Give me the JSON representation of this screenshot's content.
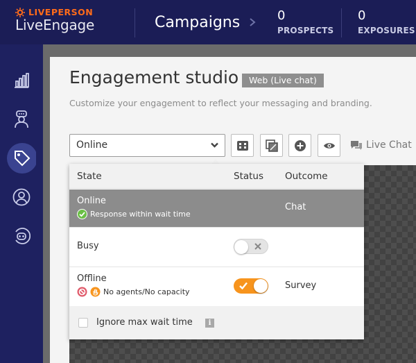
{
  "header": {
    "brand_top": "LIVEPERSON",
    "brand_bottom": "LiveEngage",
    "section_title": "Campaigns",
    "stats": [
      {
        "value": "0",
        "label": "PROSPECTS"
      },
      {
        "value": "0",
        "label": "EXPOSURES"
      }
    ]
  },
  "leftnav": {
    "items": [
      {
        "icon": "bar-chart-icon",
        "active": false
      },
      {
        "icon": "agent-icon",
        "active": false
      },
      {
        "icon": "tag-icon",
        "active": true
      },
      {
        "icon": "user-circle-icon",
        "active": false
      },
      {
        "icon": "bot-icon",
        "active": false
      }
    ]
  },
  "studio": {
    "title": "Engagement studio",
    "badge": "Web (Live chat)",
    "subtitle": "Customize your engagement to reflect your messaging and branding.",
    "state_select_value": "Online",
    "live_chat_label": "Live Chat"
  },
  "states_table": {
    "headers": {
      "state": "State",
      "status": "Status",
      "outcome": "Outcome"
    },
    "rows": [
      {
        "state": "Online",
        "sub": "Response within wait time",
        "outcome": "Chat",
        "selected": true
      },
      {
        "state": "Busy",
        "toggle": "off",
        "outcome": ""
      },
      {
        "state": "Offline",
        "sub": "No agents/No capacity",
        "toggle": "on",
        "outcome": "Survey"
      }
    ],
    "footer_label": "Ignore max wait time",
    "footer_checked": false,
    "info_glyph": "i"
  },
  "colors": {
    "header_bg": "#1b1d56",
    "accent_orange": "#f7941d",
    "selected_row": "#8c8c8c",
    "success_green": "#6abf45"
  }
}
